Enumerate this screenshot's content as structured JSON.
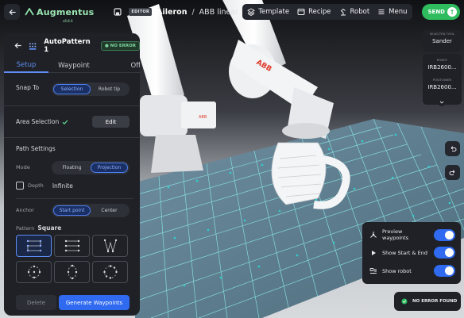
{
  "topbar": {
    "logo_text": "Augmentus",
    "logo_sub": "v6.8.0",
    "editor_badge": "EDITOR",
    "breadcrumb_project": "Aileron",
    "breadcrumb_separator": "/",
    "breadcrumb_file": "ABB linear",
    "menu": {
      "template": "Template",
      "recipe": "Recipe",
      "robot": "Robot",
      "menu": "Menu"
    },
    "send_label": "SEND"
  },
  "panel": {
    "title": "AutoPattern 1",
    "status_badge": "NO ERROR",
    "tabs": [
      "Setup",
      "Waypoint",
      "Offset"
    ],
    "active_tab": "Setup",
    "snap_to": {
      "label": "Snap To",
      "options": [
        "Selection",
        "Robot tip"
      ],
      "selected": "Selection"
    },
    "area_selection": {
      "label": "Area Selection",
      "edit_label": "Edit"
    },
    "path_settings": {
      "heading": "Path Settings",
      "mode_label": "Mode",
      "mode_options": [
        "Floating",
        "Projection"
      ],
      "mode_selected": "Projection",
      "depth_label": "Depth",
      "depth_value": "Infinite",
      "anchor_label": "Anchor",
      "anchor_options": [
        "Start point",
        "Center"
      ],
      "anchor_selected": "Start point",
      "pattern_label": "Pattern",
      "pattern_value": "Square"
    },
    "patterns": [
      "square-zigzag",
      "square-lines",
      "triangle-zigzag",
      "circle-dots",
      "oval-dots",
      "ring-dots"
    ],
    "delete_label": "Delete",
    "generate_label": "Generate Waypoints"
  },
  "right_panel": {
    "selected_tool_caption": "SELECTED TOOL",
    "selected_tool_value": "Sander",
    "robot_caption": "ROBOT",
    "robot_value": "IRB2600...",
    "positioner_caption": "POSITIONER",
    "positioner_value": "IRB2600..."
  },
  "preview": {
    "items": [
      {
        "label": "Preview waypoints",
        "icon": "waypoints-icon",
        "on": true
      },
      {
        "label": "Show Start & End",
        "icon": "play-icon",
        "on": true
      },
      {
        "label": "Show robot",
        "icon": "robot-icon",
        "on": true
      }
    ]
  },
  "status_toast": "NO ERROR FOUND",
  "colors": {
    "accent_blue": "#2f6af0",
    "success_green": "#2ebc5f",
    "panel_bg": "#1f2126",
    "grid_teal": "#2ecfd0",
    "robot_brand_red": "#e03a2b"
  }
}
